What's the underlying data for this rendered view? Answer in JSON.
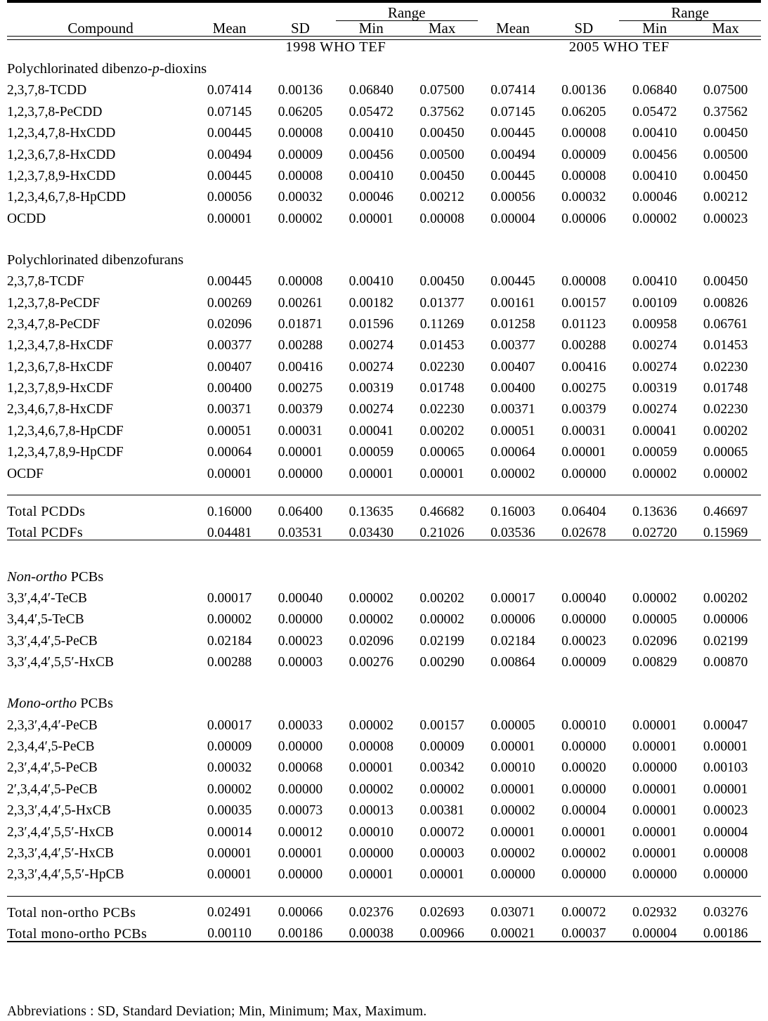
{
  "table": {
    "header": {
      "compound": "Compound",
      "mean": "Mean",
      "sd": "SD",
      "range": "Range",
      "min": "Min",
      "max": "Max"
    },
    "group_bands": {
      "left": "1998 WHO TEF",
      "right": "2005 WHO TEF"
    },
    "sections": [
      {
        "title": "Polychlorinated dibenzo-p-dioxins",
        "title_plain": "Polychlorinated dibenzo-p-dioxins",
        "italic_part": "p",
        "rows": [
          {
            "compound": "2,3,7,8-TCDD",
            "v": [
              "0.07414",
              "0.00136",
              "0.06840",
              "0.07500",
              "0.07414",
              "0.00136",
              "0.06840",
              "0.07500"
            ]
          },
          {
            "compound": "1,2,3,7,8-PeCDD",
            "v": [
              "0.07145",
              "0.06205",
              "0.05472",
              "0.37562",
              "0.07145",
              "0.06205",
              "0.05472",
              "0.37562"
            ]
          },
          {
            "compound": "1,2,3,4,7,8-HxCDD",
            "v": [
              "0.00445",
              "0.00008",
              "0.00410",
              "0.00450",
              "0.00445",
              "0.00008",
              "0.00410",
              "0.00450"
            ]
          },
          {
            "compound": "1,2,3,6,7,8-HxCDD",
            "v": [
              "0.00494",
              "0.00009",
              "0.00456",
              "0.00500",
              "0.00494",
              "0.00009",
              "0.00456",
              "0.00500"
            ]
          },
          {
            "compound": "1,2,3,7,8,9-HxCDD",
            "v": [
              "0.00445",
              "0.00008",
              "0.00410",
              "0.00450",
              "0.00445",
              "0.00008",
              "0.00410",
              "0.00450"
            ]
          },
          {
            "compound": "1,2,3,4,6,7,8-HpCDD",
            "v": [
              "0.00056",
              "0.00032",
              "0.00046",
              "0.00212",
              "0.00056",
              "0.00032",
              "0.00046",
              "0.00212"
            ]
          },
          {
            "compound": "OCDD",
            "v": [
              "0.00001",
              "0.00002",
              "0.00001",
              "0.00008",
              "0.00004",
              "0.00006",
              "0.00002",
              "0.00023"
            ]
          }
        ]
      },
      {
        "title": "Polychlorinated dibenzofurans",
        "rows": [
          {
            "compound": "2,3,7,8-TCDF",
            "v": [
              "0.00445",
              "0.00008",
              "0.00410",
              "0.00450",
              "0.00445",
              "0.00008",
              "0.00410",
              "0.00450"
            ]
          },
          {
            "compound": "1,2,3,7,8-PeCDF",
            "v": [
              "0.00269",
              "0.00261",
              "0.00182",
              "0.01377",
              "0.00161",
              "0.00157",
              "0.00109",
              "0.00826"
            ]
          },
          {
            "compound": "2,3,4,7,8-PeCDF",
            "v": [
              "0.02096",
              "0.01871",
              "0.01596",
              "0.11269",
              "0.01258",
              "0.01123",
              "0.00958",
              "0.06761"
            ]
          },
          {
            "compound": "1,2,3,4,7,8-HxCDF",
            "v": [
              "0.00377",
              "0.00288",
              "0.00274",
              "0.01453",
              "0.00377",
              "0.00288",
              "0.00274",
              "0.01453"
            ]
          },
          {
            "compound": "1,2,3,6,7,8-HxCDF",
            "v": [
              "0.00407",
              "0.00416",
              "0.00274",
              "0.02230",
              "0.00407",
              "0.00416",
              "0.00274",
              "0.02230"
            ]
          },
          {
            "compound": "1,2,3,7,8,9-HxCDF",
            "v": [
              "0.00400",
              "0.00275",
              "0.00319",
              "0.01748",
              "0.00400",
              "0.00275",
              "0.00319",
              "0.01748"
            ]
          },
          {
            "compound": "2,3,4,6,7,8-HxCDF",
            "v": [
              "0.00371",
              "0.00379",
              "0.00274",
              "0.02230",
              "0.00371",
              "0.00379",
              "0.00274",
              "0.02230"
            ]
          },
          {
            "compound": "1,2,3,4,6,7,8-HpCDF",
            "v": [
              "0.00051",
              "0.00031",
              "0.00041",
              "0.00202",
              "0.00051",
              "0.00031",
              "0.00041",
              "0.00202"
            ]
          },
          {
            "compound": "1,2,3,4,7,8,9-HpCDF",
            "v": [
              "0.00064",
              "0.00001",
              "0.00059",
              "0.00065",
              "0.00064",
              "0.00001",
              "0.00059",
              "0.00065"
            ]
          },
          {
            "compound": "OCDF",
            "v": [
              "0.00001",
              "0.00000",
              "0.00001",
              "0.00001",
              "0.00002",
              "0.00000",
              "0.00002",
              "0.00002"
            ]
          }
        ]
      }
    ],
    "totals_dioxins": [
      {
        "compound": "Total PCDDs",
        "v": [
          "0.16000",
          "0.06400",
          "0.13635",
          "0.46682",
          "0.16003",
          "0.06404",
          "0.13636",
          "0.46697"
        ]
      },
      {
        "compound": "Total PCDFs",
        "v": [
          "0.04481",
          "0.03531",
          "0.03430",
          "0.21026",
          "0.03536",
          "0.02678",
          "0.02720",
          "0.15969"
        ]
      }
    ],
    "pcb_sections": [
      {
        "title_italic": "Non-ortho",
        "title_rest": " PCBs",
        "rows": [
          {
            "compound": "3,3′,4,4′-TeCB",
            "v": [
              "0.00017",
              "0.00040",
              "0.00002",
              "0.00202",
              "0.00017",
              "0.00040",
              "0.00002",
              "0.00202"
            ]
          },
          {
            "compound": "3,4,4′,5-TeCB",
            "v": [
              "0.00002",
              "0.00000",
              "0.00002",
              "0.00002",
              "0.00006",
              "0.00000",
              "0.00005",
              "0.00006"
            ]
          },
          {
            "compound": "3,3′,4,4′,5-PeCB",
            "v": [
              "0.02184",
              "0.00023",
              "0.02096",
              "0.02199",
              "0.02184",
              "0.00023",
              "0.02096",
              "0.02199"
            ]
          },
          {
            "compound": "3,3′,4,4′,5,5′-HxCB",
            "v": [
              "0.00288",
              "0.00003",
              "0.00276",
              "0.00290",
              "0.00864",
              "0.00009",
              "0.00829",
              "0.00870"
            ]
          }
        ]
      },
      {
        "title_italic": "Mono-ortho",
        "title_rest": " PCBs",
        "rows": [
          {
            "compound": "2,3,3′,4,4′-PeCB",
            "v": [
              "0.00017",
              "0.00033",
              "0.00002",
              "0.00157",
              "0.00005",
              "0.00010",
              "0.00001",
              "0.00047"
            ]
          },
          {
            "compound": "2,3,4,4′,5-PeCB",
            "v": [
              "0.00009",
              "0.00000",
              "0.00008",
              "0.00009",
              "0.00001",
              "0.00000",
              "0.00001",
              "0.00001"
            ]
          },
          {
            "compound": "2,3′,4,4′,5-PeCB",
            "v": [
              "0.00032",
              "0.00068",
              "0.00001",
              "0.00342",
              "0.00010",
              "0.00020",
              "0.00000",
              "0.00103"
            ]
          },
          {
            "compound": "2′,3,4,4′,5-PeCB",
            "v": [
              "0.00002",
              "0.00000",
              "0.00002",
              "0.00002",
              "0.00001",
              "0.00000",
              "0.00001",
              "0.00001"
            ]
          },
          {
            "compound": "2,3,3′,4,4′,5-HxCB",
            "v": [
              "0.00035",
              "0.00073",
              "0.00013",
              "0.00381",
              "0.00002",
              "0.00004",
              "0.00001",
              "0.00023"
            ]
          },
          {
            "compound": "2,3′,4,4′,5,5′-HxCB",
            "v": [
              "0.00014",
              "0.00012",
              "0.00010",
              "0.00072",
              "0.00001",
              "0.00001",
              "0.00001",
              "0.00004"
            ]
          },
          {
            "compound": "2,3,3′,4,4′,5′-HxCB",
            "v": [
              "0.00001",
              "0.00001",
              "0.00000",
              "0.00003",
              "0.00002",
              "0.00002",
              "0.00001",
              "0.00008"
            ]
          },
          {
            "compound": "2,3,3′,4,4′,5,5′-HpCB",
            "v": [
              "0.00001",
              "0.00000",
              "0.00001",
              "0.00001",
              "0.00000",
              "0.00000",
              "0.00000",
              "0.00000"
            ]
          }
        ]
      }
    ],
    "totals_pcb": [
      {
        "compound": "Total non-ortho PCBs",
        "v": [
          "0.02491",
          "0.00066",
          "0.02376",
          "0.02693",
          "0.03071",
          "0.00072",
          "0.02932",
          "0.03276"
        ]
      },
      {
        "compound": "Total mono-ortho PCBs",
        "v": [
          "0.00110",
          "0.00186",
          "0.00038",
          "0.00966",
          "0.00021",
          "0.00037",
          "0.00004",
          "0.00186"
        ]
      }
    ],
    "footnote": "Abbreviations : SD, Standard Deviation; Min, Minimum; Max, Maximum."
  }
}
